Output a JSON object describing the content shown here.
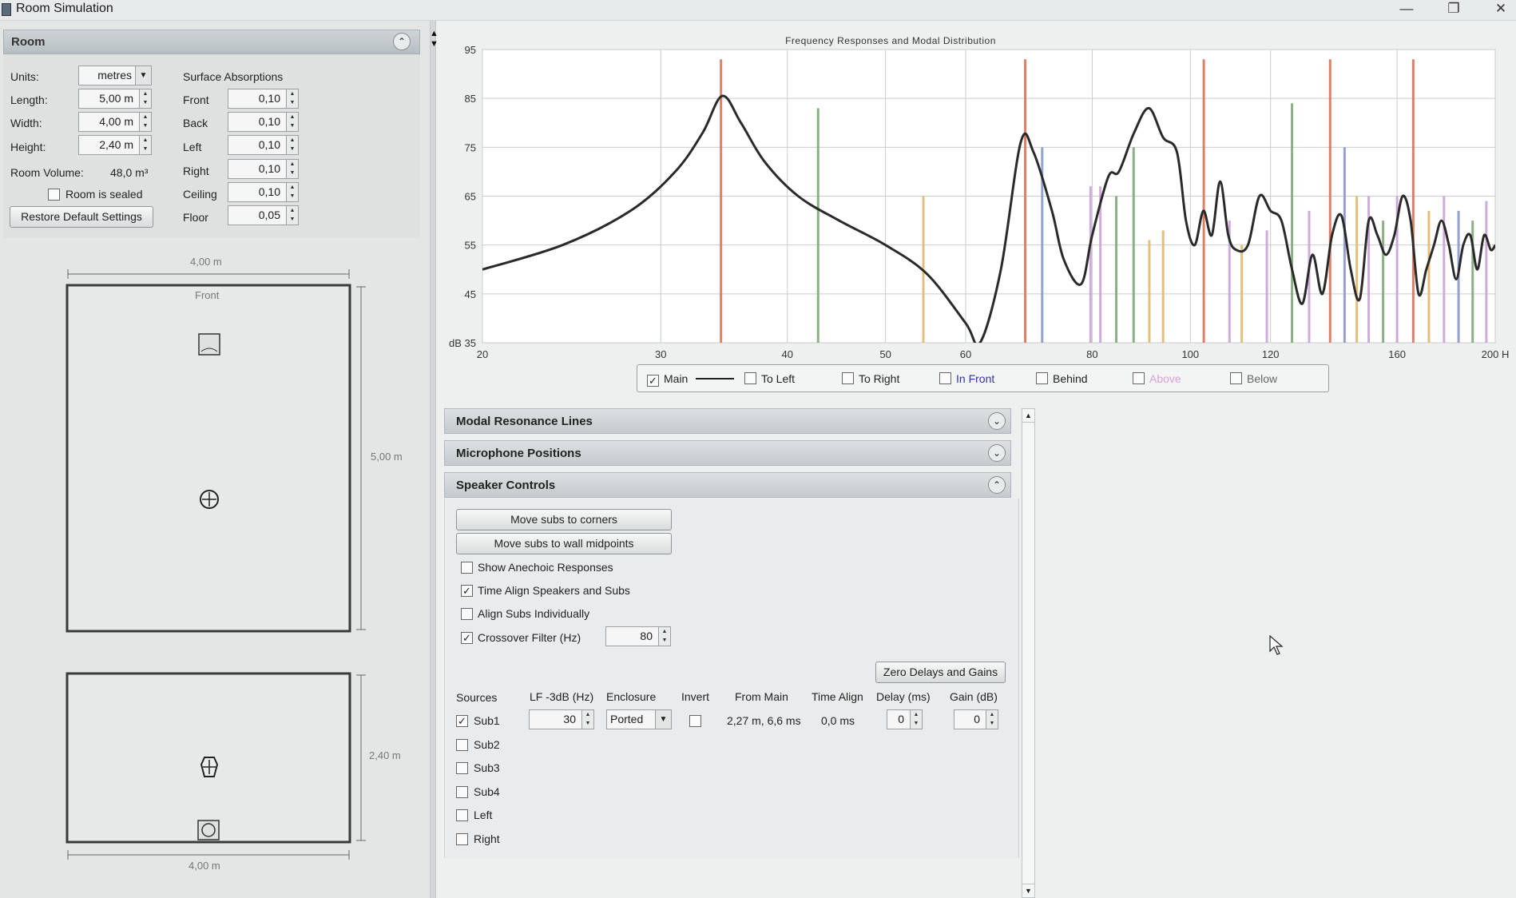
{
  "window": {
    "title": "Room Simulation",
    "minimize": "—",
    "restore": "❐",
    "close": "✕"
  },
  "room": {
    "header": "Room",
    "units_label": "Units:",
    "units_value": "metres",
    "length_label": "Length:",
    "length_value": "5,00 m",
    "width_label": "Width:",
    "width_value": "4,00 m",
    "height_label": "Height:",
    "height_value": "2,40 m",
    "volume_label": "Room Volume:",
    "volume_value": "48,0 m³",
    "sealed_label": "Room is sealed",
    "restore_button": "Restore Default Settings",
    "absorptions_title": "Surface Absorptions",
    "absorptions": [
      {
        "label": "Front",
        "value": "0,10"
      },
      {
        "label": "Back",
        "value": "0,10"
      },
      {
        "label": "Left",
        "value": "0,10"
      },
      {
        "label": "Right",
        "value": "0,10"
      },
      {
        "label": "Ceiling",
        "value": "0,10"
      },
      {
        "label": "Floor",
        "value": "0,05"
      }
    ]
  },
  "plan": {
    "top_width": "4,00 m",
    "front_label": "Front",
    "length_dim": "5,00 m",
    "height_dim": "2,40 m",
    "bottom_width": "4,00 m"
  },
  "chart_data": {
    "type": "line",
    "title": "Frequency Responses and Modal Distribution",
    "ylabel": "dB",
    "xscale": "log",
    "xlim": [
      20,
      200
    ],
    "ylim": [
      35,
      95
    ],
    "x_ticks": [
      20,
      30,
      40,
      50,
      60,
      80,
      100,
      120,
      160,
      200
    ],
    "y_ticks": [
      35,
      45,
      55,
      65,
      75,
      85,
      95
    ],
    "grid": true,
    "series": [
      {
        "name": "Main",
        "points": [
          [
            20,
            50
          ],
          [
            24,
            55
          ],
          [
            28,
            62
          ],
          [
            31,
            70
          ],
          [
            33,
            78
          ],
          [
            34.5,
            85.5
          ],
          [
            36,
            80
          ],
          [
            38,
            72
          ],
          [
            41,
            65
          ],
          [
            45,
            60
          ],
          [
            50,
            55
          ],
          [
            55,
            49
          ],
          [
            60,
            39
          ],
          [
            62,
            35
          ],
          [
            65,
            50
          ],
          [
            68,
            76
          ],
          [
            70,
            74
          ],
          [
            73,
            62
          ],
          [
            75,
            52
          ],
          [
            78,
            47
          ],
          [
            80,
            57
          ],
          [
            83,
            69
          ],
          [
            85,
            70
          ],
          [
            88,
            78
          ],
          [
            91,
            83
          ],
          [
            94,
            77
          ],
          [
            97,
            74
          ],
          [
            99,
            60
          ],
          [
            101,
            55
          ],
          [
            103,
            62
          ],
          [
            105,
            57
          ],
          [
            107,
            68
          ],
          [
            109,
            57
          ],
          [
            111,
            54
          ],
          [
            114,
            55
          ],
          [
            117,
            65
          ],
          [
            120,
            62
          ],
          [
            123,
            60
          ],
          [
            126,
            50
          ],
          [
            129,
            43
          ],
          [
            132,
            53
          ],
          [
            135,
            45
          ],
          [
            138,
            57
          ],
          [
            141,
            61
          ],
          [
            144,
            50
          ],
          [
            147,
            44
          ],
          [
            150,
            60
          ],
          [
            153,
            57
          ],
          [
            156,
            53
          ],
          [
            159,
            57
          ],
          [
            162,
            65
          ],
          [
            165,
            60
          ],
          [
            168,
            45
          ],
          [
            171,
            50
          ],
          [
            174,
            55
          ],
          [
            177,
            60
          ],
          [
            180,
            55
          ],
          [
            183,
            48
          ],
          [
            186,
            55
          ],
          [
            189,
            57
          ],
          [
            192,
            50
          ],
          [
            195,
            57
          ],
          [
            198,
            54
          ],
          [
            200,
            55
          ]
        ]
      }
    ],
    "modal_lines": [
      {
        "freq": 34.4,
        "level": 93,
        "color": "#d9735a"
      },
      {
        "freq": 42.9,
        "level": 83,
        "color": "#7fa87a"
      },
      {
        "freq": 54.5,
        "level": 65,
        "color": "#e2b86e"
      },
      {
        "freq": 68.7,
        "level": 93,
        "color": "#d9735a"
      },
      {
        "freq": 71.4,
        "level": 75,
        "color": "#8899cc"
      },
      {
        "freq": 79.7,
        "level": 67,
        "color": "#c8a4d8"
      },
      {
        "freq": 81.5,
        "level": 67,
        "color": "#c8a4d8"
      },
      {
        "freq": 84.5,
        "level": 65,
        "color": "#7fa87a"
      },
      {
        "freq": 87.9,
        "level": 75,
        "color": "#7fa87a"
      },
      {
        "freq": 91.1,
        "level": 56,
        "color": "#e2b86e"
      },
      {
        "freq": 94.0,
        "level": 58,
        "color": "#e2b86e"
      },
      {
        "freq": 103.1,
        "level": 93,
        "color": "#d9735a"
      },
      {
        "freq": 109.3,
        "level": 60,
        "color": "#c8a4d8"
      },
      {
        "freq": 112.4,
        "level": 55,
        "color": "#e2b86e"
      },
      {
        "freq": 119.0,
        "level": 58,
        "color": "#c8a4d8"
      },
      {
        "freq": 126.0,
        "level": 84,
        "color": "#7fa87a"
      },
      {
        "freq": 131.0,
        "level": 62,
        "color": "#c8a4d8"
      },
      {
        "freq": 137.4,
        "level": 93,
        "color": "#d9735a"
      },
      {
        "freq": 142.0,
        "level": 75,
        "color": "#8899cc"
      },
      {
        "freq": 146.0,
        "level": 65,
        "color": "#e2b86e"
      },
      {
        "freq": 150.0,
        "level": 65,
        "color": "#c8a4d8"
      },
      {
        "freq": 155.0,
        "level": 60,
        "color": "#7fa87a"
      },
      {
        "freq": 160.0,
        "level": 65,
        "color": "#c8a4d8"
      },
      {
        "freq": 166.0,
        "level": 93,
        "color": "#d9735a"
      },
      {
        "freq": 172.0,
        "level": 62,
        "color": "#e2b86e"
      },
      {
        "freq": 178.0,
        "level": 65,
        "color": "#c8a4d8"
      },
      {
        "freq": 184.0,
        "level": 62,
        "color": "#8899cc"
      },
      {
        "freq": 190.0,
        "level": 60,
        "color": "#7fa87a"
      },
      {
        "freq": 196.0,
        "level": 64,
        "color": "#c8a4d8"
      }
    ]
  },
  "chart_labels": {
    "x0": "20",
    "y0": "dB 35",
    "xlast": "200 H"
  },
  "legend": {
    "items": [
      {
        "label": "Main",
        "checked": true,
        "color": "#222222"
      },
      {
        "label": "To Left",
        "checked": false,
        "color": "#444444"
      },
      {
        "label": "To Right",
        "checked": false,
        "color": "#444444"
      },
      {
        "label": "In Front",
        "checked": false,
        "color": "#333399"
      },
      {
        "label": "Behind",
        "checked": false,
        "color": "#222222"
      },
      {
        "label": "Above",
        "checked": false,
        "color": "#d8a0d8"
      },
      {
        "label": "Below",
        "checked": false,
        "color": "#666666"
      }
    ]
  },
  "panels": {
    "modal": "Modal Resonance Lines",
    "mic": "Microphone Positions",
    "speaker": "Speaker Controls"
  },
  "speaker": {
    "move_corners": "Move subs to corners",
    "move_midpoints": "Move subs to wall midpoints",
    "show_anechoic": "Show Anechoic Responses",
    "time_align": "Time Align Speakers and Subs",
    "align_individually": "Align Subs Individually",
    "crossover": "Crossover Filter (Hz)",
    "crossover_value": "80",
    "zero_button": "Zero Delays and Gains",
    "columns": {
      "sources": "Sources",
      "lf": "LF -3dB (Hz)",
      "enclosure": "Enclosure",
      "invert": "Invert",
      "from_main": "From Main",
      "time_align": "Time Align",
      "delay": "Delay (ms)",
      "gain": "Gain (dB)"
    },
    "sub1": {
      "name": "Sub1",
      "lf": "30",
      "enclosure": "Ported",
      "from_main": "2,27 m, 6,6 ms",
      "time_align": "0,0 ms",
      "delay": "0",
      "gain": "0"
    },
    "sources": [
      "Sub2",
      "Sub3",
      "Sub4",
      "Left",
      "Right"
    ]
  }
}
